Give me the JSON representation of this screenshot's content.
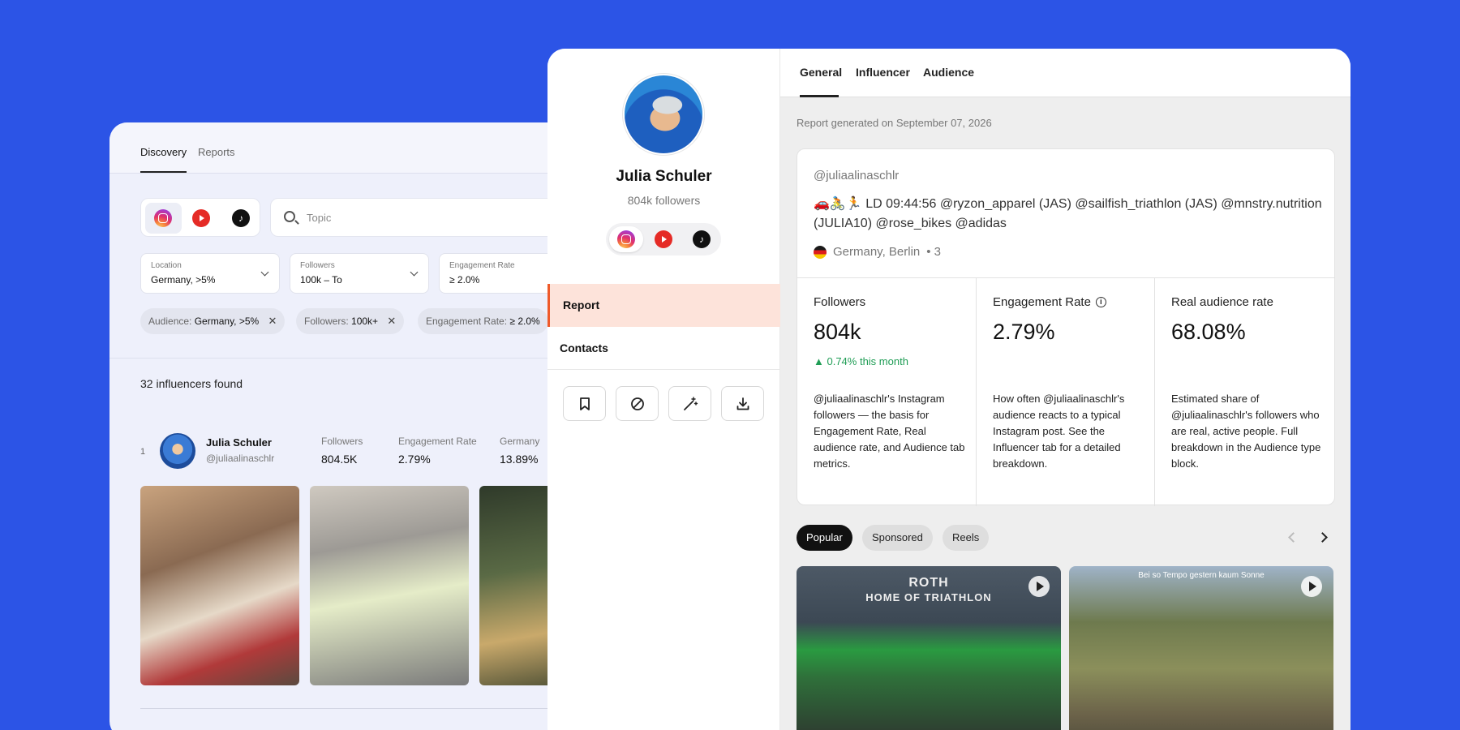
{
  "discovery": {
    "tabs": [
      "Discovery",
      "Reports"
    ],
    "search_placeholder": "Topic",
    "filters": [
      {
        "label": "Location",
        "value": "Germany, >5%"
      },
      {
        "label": "Followers",
        "value": "100k – To"
      },
      {
        "label": "Engagement Rate",
        "value": "≥ 2.0%"
      }
    ],
    "chips": [
      {
        "label": "Audience:",
        "value": "Germany, >5%"
      },
      {
        "label": "Followers:",
        "value": "100k+"
      },
      {
        "label": "Engagement Rate:",
        "value": "≥ 2.0%"
      }
    ],
    "results_count": "32 influencers found",
    "result": {
      "rank": "1",
      "name": "Julia Schuler",
      "handle": "@juliaalinaschlr",
      "metrics": [
        {
          "label": "Followers",
          "value": "804.5K"
        },
        {
          "label": "Engagement Rate",
          "value": "2.79%"
        },
        {
          "label": "Germany",
          "value": "13.89%"
        }
      ]
    }
  },
  "profile": {
    "name": "Julia Schuler",
    "followers": "804k followers",
    "nav": [
      "Report",
      "Contacts"
    ],
    "actions": [
      "bookmark-icon",
      "block-icon",
      "magic-wand-icon",
      "download-icon"
    ]
  },
  "report": {
    "tabs": [
      "General",
      "Influencer",
      "Audience"
    ],
    "generated": "Report generated on September 07, 2026",
    "handle": "@juliaalinaschlr",
    "bio": "🚗🚴🏃 LD 09:44:56 @ryzon_apparel (JAS) @sailfish_triathlon (JAS) @mnstry.nutrition (JULIA10) @rose_bikes @adidas",
    "location": "Germany, Berlin",
    "location_extra": "• 3",
    "stats": [
      {
        "label": "Followers",
        "value": "804k",
        "delta": "▲ 0.74% this month",
        "desc": "@juliaalinaschlr's Instagram followers — the basis for Engagement Rate, Real audience rate, and Audience tab metrics."
      },
      {
        "label": "Engagement Rate",
        "value": "2.79%",
        "delta": "",
        "desc": "How often @juliaalinaschlr's audience reacts to a typical Instagram post. See the Influencer tab for a detailed breakdown."
      },
      {
        "label": "Real audience rate",
        "value": "68.08%",
        "delta": "",
        "desc": "Estimated share of @juliaalinaschlr's followers who are real, active people. Full breakdown in the Audience type block."
      }
    ],
    "content_tabs": [
      "Popular",
      "Sponsored",
      "Reels"
    ],
    "media": [
      {
        "overlay": "ROTH",
        "sub": "HOME OF TRIATHLON"
      },
      {
        "overlay": "",
        "sub": "Bei so Tempo gestern kaum Sonne"
      }
    ]
  },
  "colors": {
    "background": "#2c54e6",
    "accent": "#ef5a2a",
    "positive": "#1f9d55"
  }
}
